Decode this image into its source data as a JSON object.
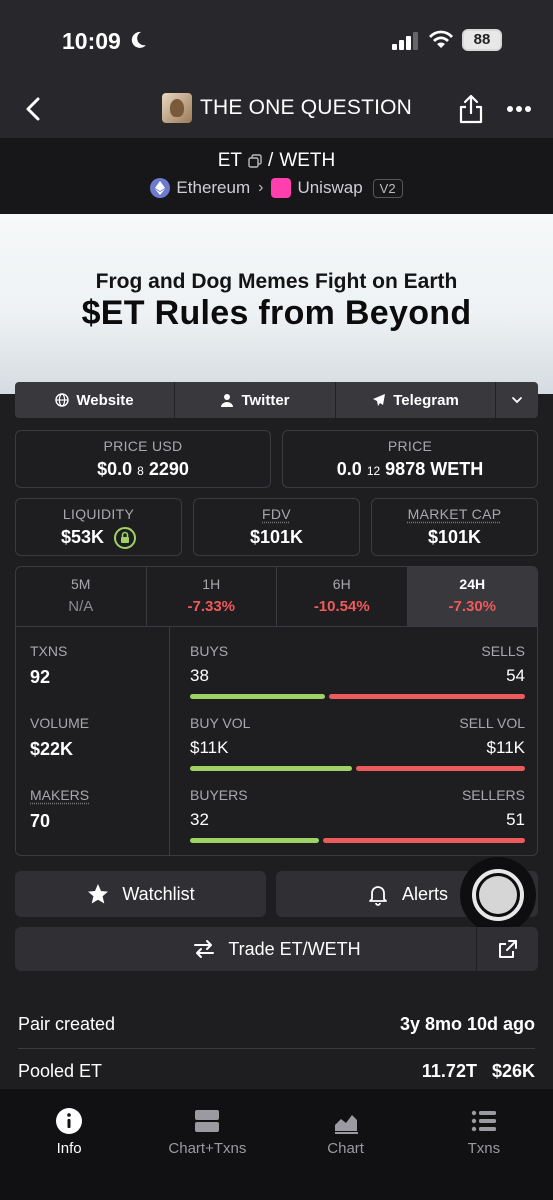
{
  "status": {
    "time": "10:09",
    "battery": "88"
  },
  "header": {
    "title": "THE ONE QUESTION"
  },
  "pair": {
    "base": "ET",
    "separator": "/",
    "quote": "WETH",
    "chain": "Ethereum",
    "dex": "Uniswap",
    "version": "V2"
  },
  "banner": {
    "line1": "Frog and Dog Memes Fight on Earth",
    "line2": "$ET Rules from Beyond"
  },
  "links": [
    {
      "label": "Website",
      "icon": "globe-icon"
    },
    {
      "label": "Twitter",
      "icon": "user-icon"
    },
    {
      "label": "Telegram",
      "icon": "paper-plane-icon"
    }
  ],
  "prices": {
    "price_usd_label": "PRICE USD",
    "price_usd_prefix": "$0.0",
    "price_usd_sub": "8",
    "price_usd_rest": "2290",
    "price_label": "PRICE",
    "price_prefix": "0.0",
    "price_sub": "12",
    "price_rest": "9878 WETH"
  },
  "metrics": {
    "liquidity_label": "LIQUIDITY",
    "liquidity": "$53K",
    "fdv_label": "FDV",
    "fdv": "$101K",
    "mcap_label": "MARKET CAP",
    "mcap": "$101K"
  },
  "timeframes": [
    {
      "label": "5M",
      "value": "N/A"
    },
    {
      "label": "1H",
      "value": "-7.33%"
    },
    {
      "label": "6H",
      "value": "-10.54%"
    },
    {
      "label": "24H",
      "value": "-7.30%",
      "active": true
    }
  ],
  "stats": {
    "txns_label": "TXNS",
    "txns": "92",
    "volume_label": "VOLUME",
    "volume": "$22K",
    "makers_label": "MAKERS",
    "makers": "70",
    "buys_label": "BUYS",
    "buys": "38",
    "sells_label": "SELLS",
    "sells": "54",
    "buyvol_label": "BUY VOL",
    "buyvol": "$11K",
    "sellvol_label": "SELL VOL",
    "sellvol": "$11K",
    "buyers_label": "BUYERS",
    "buyers": "32",
    "sellers_label": "SELLERS",
    "sellers": "51"
  },
  "ratios": {
    "buys_fraction": 0.41,
    "buyvol_fraction": 0.49,
    "buyers_fraction": 0.39
  },
  "colors": {
    "buy": "#9fd266",
    "sell": "#ec5b5b",
    "negative": "#f05a5a"
  },
  "actions": {
    "watchlist": "Watchlist",
    "alerts": "Alerts",
    "trade": "Trade ET/WETH"
  },
  "info": [
    {
      "label": "Pair created",
      "value": "3y 8mo 10d ago"
    },
    {
      "label": "Pooled ET",
      "value": "11.72T",
      "value2": "$26K"
    }
  ],
  "nav": [
    {
      "label": "Info",
      "active": true
    },
    {
      "label": "Chart+Txns"
    },
    {
      "label": "Chart"
    },
    {
      "label": "Txns"
    }
  ]
}
